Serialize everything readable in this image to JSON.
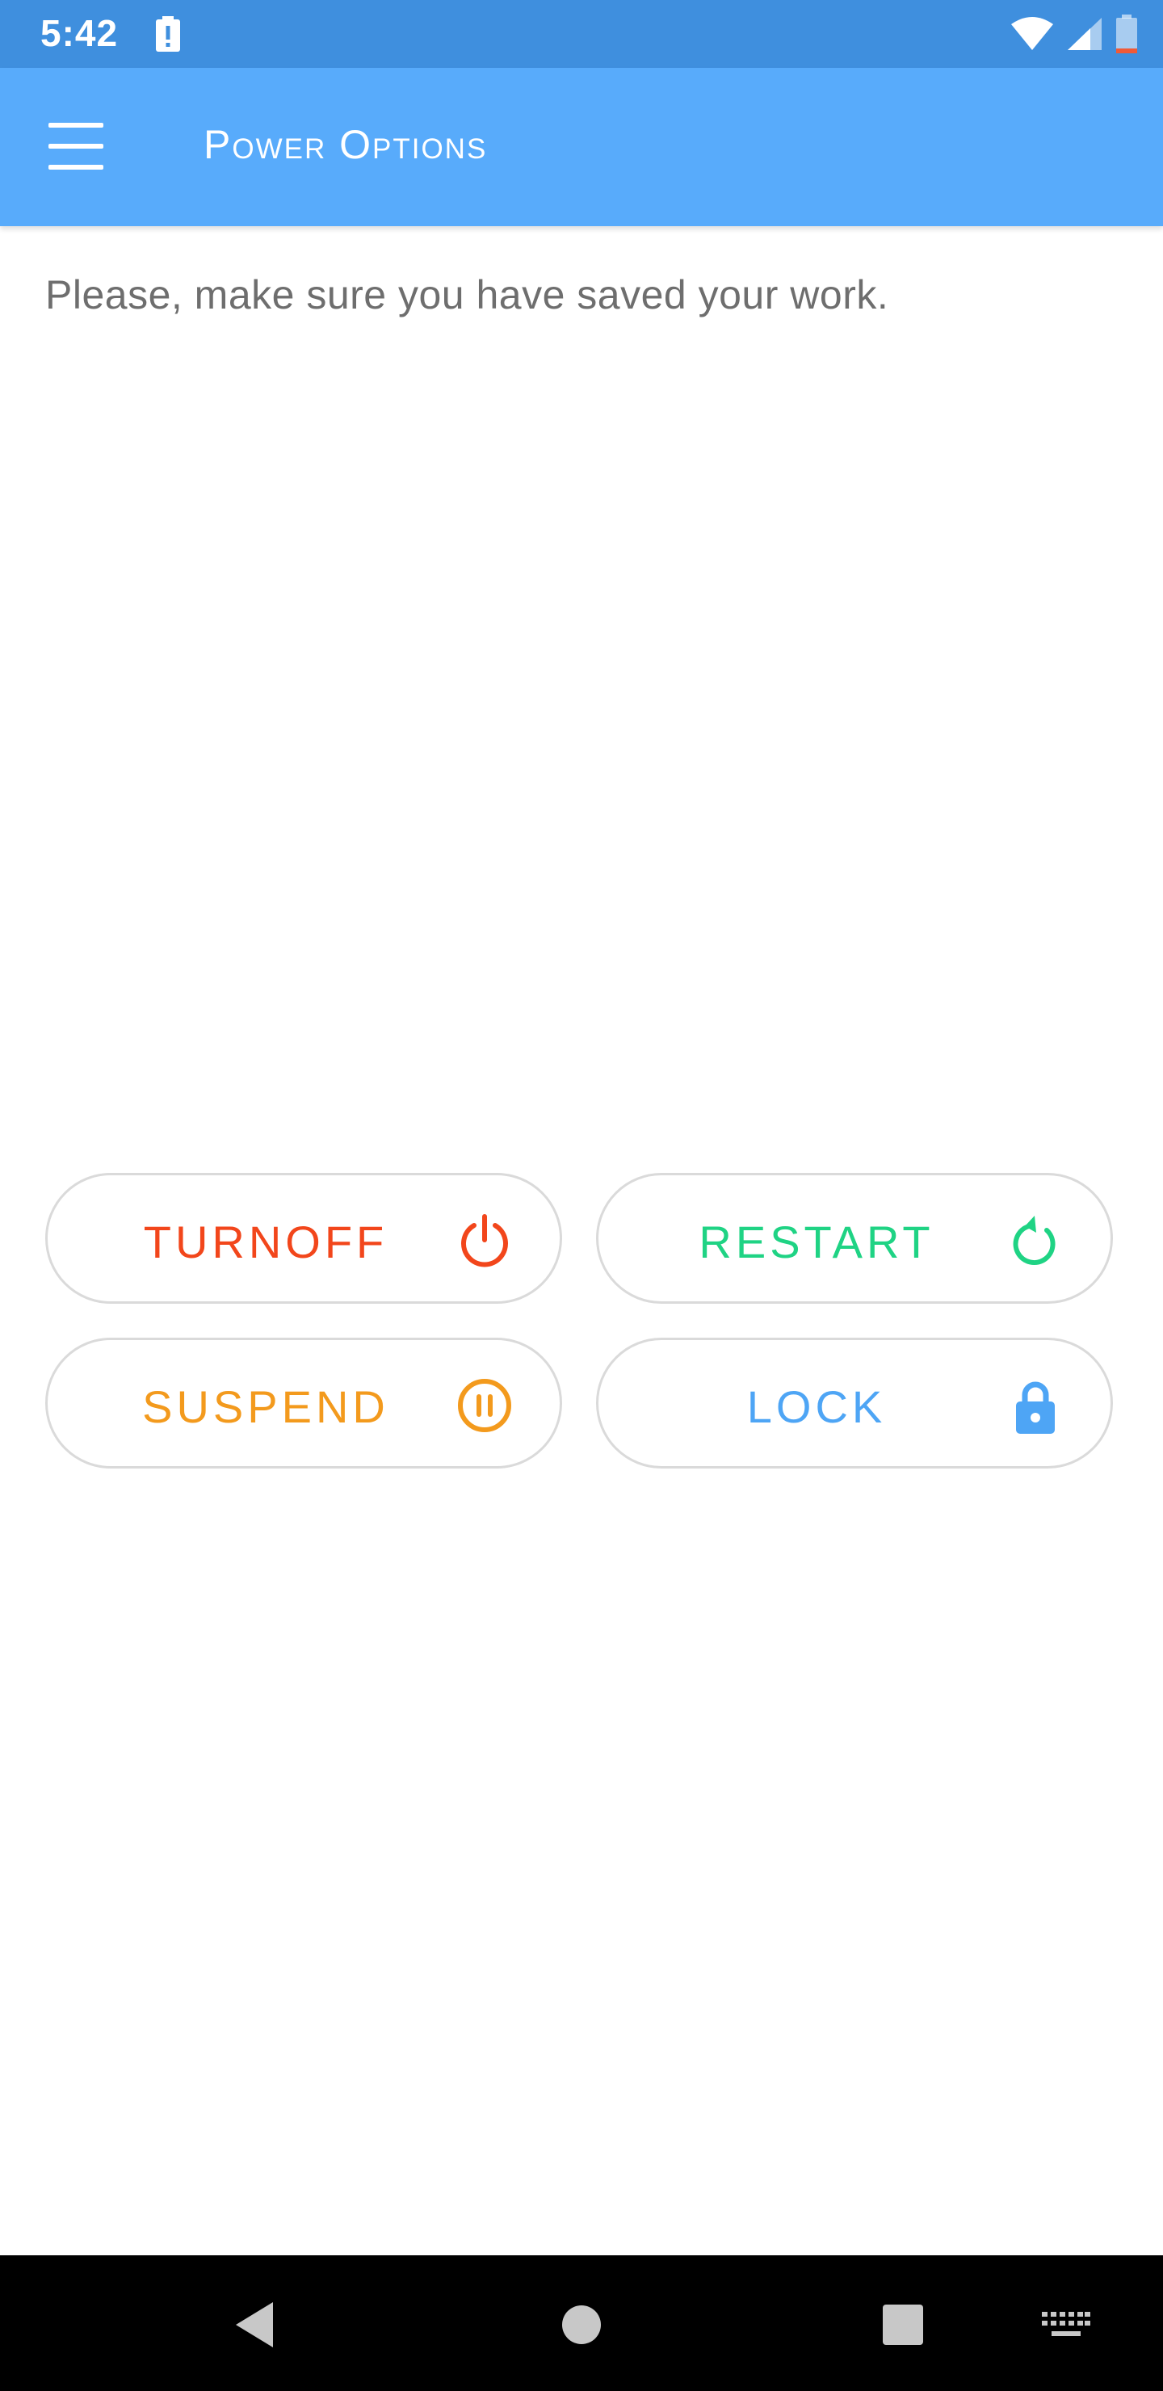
{
  "status_bar": {
    "time": "5:42"
  },
  "app_bar": {
    "title": "Power Options"
  },
  "message": "Please, make sure you have saved your work.",
  "buttons": {
    "turnoff": {
      "label": "TURNOFF",
      "icon": "power-icon",
      "color": "#f2461b"
    },
    "restart": {
      "label": "RESTART",
      "icon": "restart-icon",
      "color": "#1fd384"
    },
    "suspend": {
      "label": "SUSPEND",
      "icon": "pause-icon",
      "color": "#f39a1d"
    },
    "lock": {
      "label": "LOCK",
      "icon": "lock-icon",
      "color": "#4ea5f5"
    }
  },
  "colors": {
    "status_bar": "#3f8fde",
    "app_bar": "#58abfb",
    "button_border": "#dadada",
    "message_text": "#6e6e6e"
  }
}
